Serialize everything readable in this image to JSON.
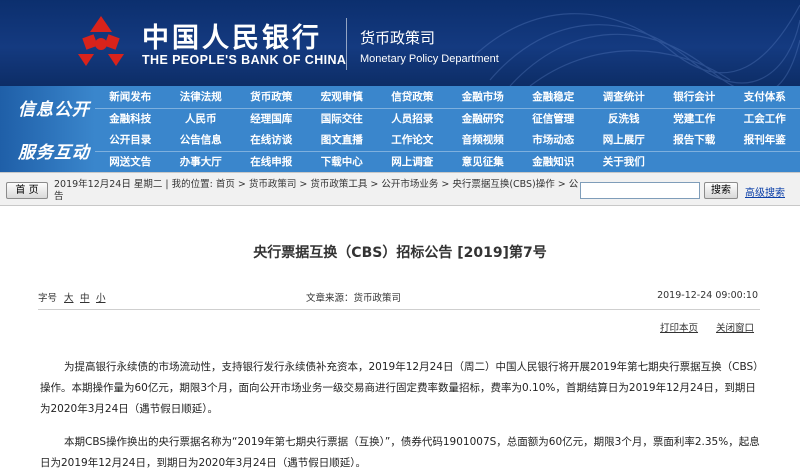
{
  "colors": {
    "header_bg": "#143a80",
    "nav_bg": "#3a86cc",
    "emblem_red": "#d8231b",
    "link_blue": "#0b3fa8"
  },
  "header": {
    "logo_cn": "中国人民银行",
    "logo_en": "THE PEOPLE'S BANK OF CHINA",
    "dept_cn": "货币政策司",
    "dept_en": "Monetary Policy Department",
    "emblem_icon": "pboc-emblem-icon"
  },
  "nav_info": {
    "label": "信息公开",
    "row1": [
      "新闻发布",
      "法律法规",
      "货币政策",
      "宏观审慎",
      "信贷政策",
      "金融市场",
      "金融稳定",
      "调查统计",
      "银行会计",
      "支付体系"
    ],
    "row2": [
      "金融科技",
      "人民币",
      "经理国库",
      "国际交往",
      "人员招录",
      "金融研究",
      "征信管理",
      "反洗钱",
      "党建工作",
      "工会工作"
    ]
  },
  "nav_service": {
    "label": "服务互动",
    "row1": [
      "公开目录",
      "公告信息",
      "在线访谈",
      "图文直播",
      "工作论文",
      "音频视频",
      "市场动态",
      "网上展厅",
      "报告下载",
      "报刊年鉴"
    ],
    "row2": [
      "网送文告",
      "办事大厅",
      "在线申报",
      "下载中心",
      "网上调查",
      "意见征集",
      "金融知识",
      "关于我们"
    ]
  },
  "breadcrumb": {
    "home_label": "首 页",
    "date": "2019年12月24日 星期二",
    "location_label": "我的位置:",
    "items": [
      "首页",
      "货币政策司",
      "货币政策工具",
      "公开市场业务",
      "央行票据互换(CBS)操作",
      "公告"
    ],
    "sep": ">"
  },
  "search": {
    "placeholder": "",
    "button_label": "搜索",
    "advanced_label": "高级搜索"
  },
  "article": {
    "title": "央行票据互换（CBS）招标公告 [2019]第7号",
    "font_size_label": "字号",
    "font_sizes": [
      "大",
      "中",
      "小"
    ],
    "source": "文章来源：货币政策司",
    "date": "2019-12-24 09:00:10",
    "print_label": "打印本页",
    "close_label": "关闭窗口",
    "paragraphs": [
      "为提高银行永续债的市场流动性，支持银行发行永续债补充资本，2019年12月24日（周二）中国人民银行将开展2019年第七期央行票据互换（CBS）操作。本期操作量为60亿元，期限3个月，面向公开市场业务一级交易商进行固定费率数量招标，费率为0.10%，首期结算日为2019年12月24日，到期日为2020年3月24日（遇节假日顺延）。",
      "本期CBS操作换出的央行票据名称为“2019年第七期央行票据（互换）”，债券代码1901007S，总面额为60亿元，期限3个月，票面利率2.35%，起息日为2019年12月24日，到期日为2020年3月24日（遇节假日顺延）。"
    ]
  }
}
